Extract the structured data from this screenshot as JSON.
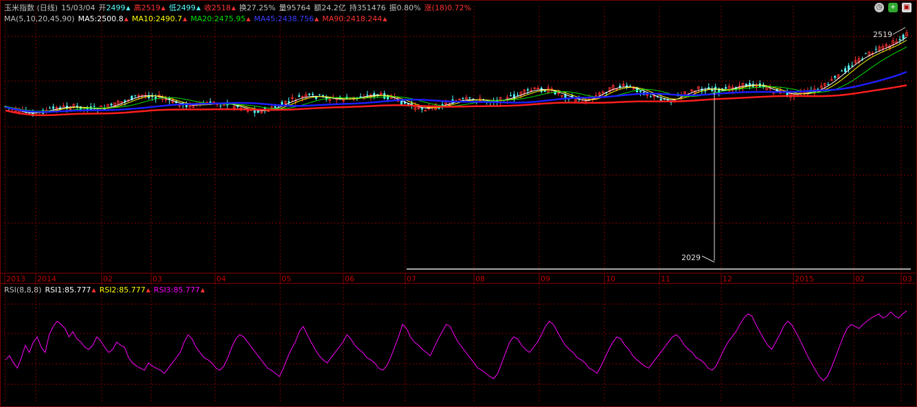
{
  "header": {
    "symbol": "玉米指数 (日线)",
    "date": "15/03/04",
    "open_label": "开",
    "open": "2499",
    "high_label": "高",
    "high": "2519",
    "low_label": "低",
    "low": "2499",
    "close_label": "收",
    "close": "2518",
    "turnover_label": "换",
    "turnover": "27.25%",
    "volume_label": "量",
    "volume": "95764",
    "amount_label": "额",
    "amount": "24.2亿",
    "oi_label": "持",
    "oi": "351476",
    "amp_label": "振",
    "amp": "0.80%",
    "chg_label": "涨(18)",
    "chg": "0.72%"
  },
  "ma_line": {
    "label": "MA(5,10,20,45,90)",
    "ma5": "MA5:2500.8",
    "ma10": "MA10:2490.7",
    "ma20": "MA20:2475.95",
    "ma45": "MA45:2438.756",
    "ma90": "MA90:2418.244"
  },
  "rsi_line": {
    "label": "RSI(8,8,8)",
    "rsi1": "RSI1:85.777",
    "rsi2": "RSI2:85.777",
    "rsi3": "RSI3:85.777"
  },
  "markers": {
    "high_label": "2519",
    "low_label": "2029"
  },
  "icons": [
    "clock-icon",
    "add-icon",
    "window-icon"
  ],
  "colors": {
    "up": "#ff3232",
    "down": "#54fcfc",
    "grid": "#8b0000",
    "ma5": "#ffffff",
    "ma10": "#ffff00",
    "ma20": "#00e000",
    "ma45": "#1e1eff",
    "ma90": "#ff1e1e",
    "rsi": "#ff00ff"
  },
  "chart_data": {
    "type": "line",
    "axis_labels": [
      "2013",
      "2014",
      "02",
      "03",
      "04",
      "05",
      "06",
      "07",
      "08",
      "09",
      "10",
      "11",
      "12",
      "2015",
      "02",
      "03"
    ],
    "annotations": [
      "2519",
      "2029"
    ],
    "series": [
      {
        "name": "MA5"
      },
      {
        "name": "MA10"
      },
      {
        "name": "MA20"
      },
      {
        "name": "MA45"
      },
      {
        "name": "MA90"
      },
      {
        "name": "RSI1"
      }
    ],
    "rsi_values": [
      38,
      42,
      35,
      30,
      40,
      52,
      45,
      55,
      60,
      50,
      45,
      62,
      70,
      75,
      72,
      68,
      60,
      65,
      58,
      55,
      50,
      48,
      52,
      60,
      56,
      50,
      45,
      48,
      55,
      52,
      50,
      40,
      35,
      32,
      30,
      28,
      35,
      32,
      30,
      28,
      25,
      30,
      35,
      40,
      45,
      55,
      62,
      58,
      50,
      45,
      40,
      38,
      35,
      30,
      28,
      32,
      40,
      50,
      58,
      62,
      60,
      55,
      50,
      45,
      40,
      35,
      30,
      28,
      25,
      22,
      30,
      40,
      48,
      55,
      65,
      70,
      62,
      55,
      48,
      42,
      38,
      35,
      40,
      45,
      50,
      55,
      62,
      58,
      52,
      48,
      45,
      40,
      38,
      35,
      30,
      28,
      32,
      40,
      50,
      60,
      72,
      68,
      60,
      55,
      52,
      48,
      45,
      42,
      50,
      58,
      65,
      72,
      70,
      62,
      55,
      50,
      45,
      40,
      35,
      30,
      28,
      25,
      22,
      20,
      25,
      35,
      45,
      55,
      60,
      58,
      52,
      48,
      45,
      50,
      55,
      62,
      70,
      75,
      72,
      65,
      58,
      52,
      48,
      45,
      40,
      38,
      35,
      30,
      28,
      25,
      32,
      40,
      48,
      55,
      60,
      58,
      52,
      48,
      42,
      38,
      35,
      32,
      30,
      35,
      40,
      45,
      50,
      55,
      60,
      62,
      58,
      52,
      48,
      45,
      40,
      38,
      35,
      30,
      28,
      32,
      40,
      48,
      55,
      60,
      65,
      72,
      78,
      82,
      80,
      72,
      65,
      58,
      52,
      48,
      55,
      62,
      70,
      75,
      72,
      65,
      58,
      50,
      42,
      35,
      28,
      22,
      18,
      22,
      30,
      40,
      50,
      60,
      68,
      72,
      70,
      68,
      72,
      75,
      78,
      80,
      82,
      78,
      80,
      84,
      80,
      78,
      82,
      85
    ]
  }
}
